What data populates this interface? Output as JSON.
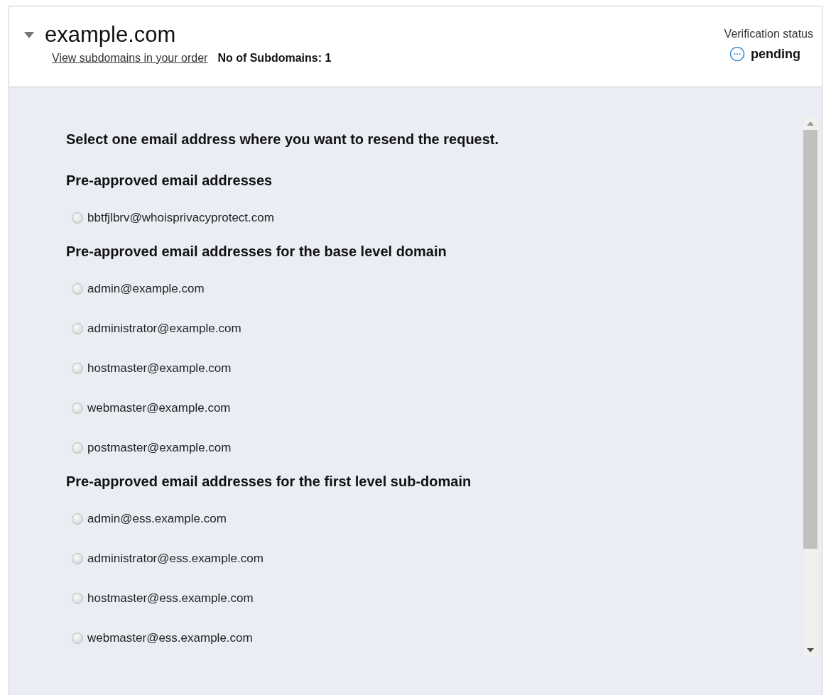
{
  "domain": {
    "name": "example.com",
    "expanded": true,
    "link": "View subdomains in your order",
    "subdomain_count": "No of Subdomains: 1"
  },
  "verification": {
    "label": "Verification status",
    "status": "pending"
  },
  "instruction": "Select one email address where you want to resend the request.",
  "groups": [
    {
      "title": "Pre-approved email addresses",
      "options": [
        {
          "email": "bbtfjlbrv@whoisprivacyprotect.com",
          "selected": false
        }
      ]
    },
    {
      "title": "Pre-approved email addresses for the base level domain",
      "options": [
        {
          "email": "admin@example.com",
          "selected": false
        },
        {
          "email": "administrator@example.com",
          "selected": false
        },
        {
          "email": "hostmaster@example.com",
          "selected": false
        },
        {
          "email": "webmaster@example.com",
          "selected": false
        },
        {
          "email": "postmaster@example.com",
          "selected": false
        }
      ]
    },
    {
      "title": "Pre-approved email addresses for the first level sub-domain",
      "options": [
        {
          "email": "admin@ess.example.com",
          "selected": false
        },
        {
          "email": "administrator@ess.example.com",
          "selected": false
        },
        {
          "email": "hostmaster@ess.example.com",
          "selected": false
        },
        {
          "email": "webmaster@ess.example.com",
          "selected": false
        }
      ]
    }
  ]
}
